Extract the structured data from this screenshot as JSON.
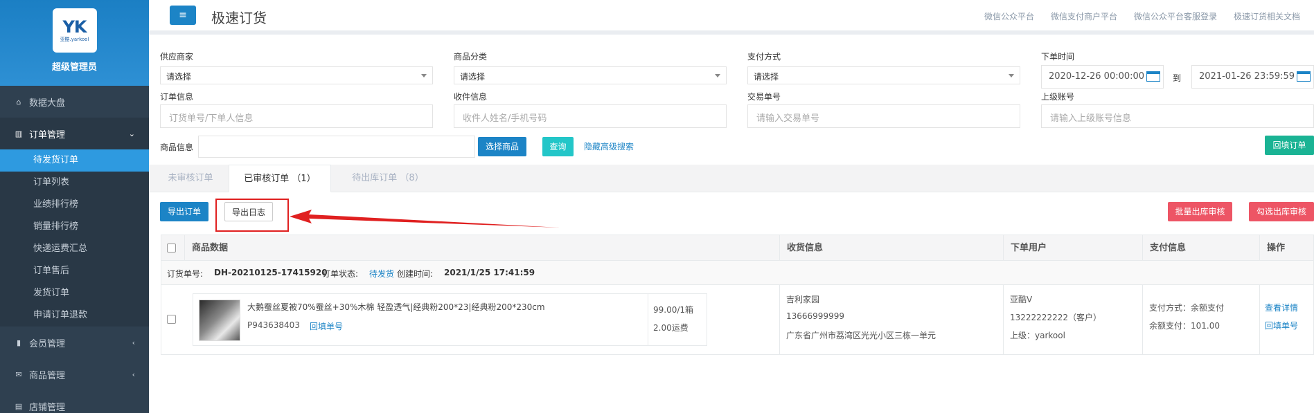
{
  "sidebar": {
    "logo_mark": "YK",
    "logo_text": "亚酷.yarkool",
    "profile_name": "超级管理员",
    "items": [
      {
        "label": "数据大盘",
        "icon": "home-icon"
      },
      {
        "label": "订单管理",
        "icon": "columns-icon",
        "open": true
      },
      {
        "label": "会员管理",
        "icon": "bar-chart-icon"
      },
      {
        "label": "商品管理",
        "icon": "envelope-icon"
      },
      {
        "label": "店铺管理",
        "icon": "store-icon"
      }
    ],
    "sub_items": [
      "待发货订单",
      "订单列表",
      "业绩排行榜",
      "销量排行榜",
      "快递运费汇总",
      "订单售后",
      "发货订单",
      "申请订单退款"
    ]
  },
  "header": {
    "title": "极速订货",
    "links": [
      "微信公众平台",
      "微信支付商户平台",
      "微信公众平台客服登录",
      "极速订货相关文档"
    ]
  },
  "filters": {
    "supplier_label": "供应商家",
    "supplier_value": "请选择",
    "category_label": "商品分类",
    "category_value": "请选择",
    "payment_label": "支付方式",
    "payment_value": "请选择",
    "order_time_label": "下单时间",
    "date_from": "2020-12-26 00:00:00",
    "date_to_label": "到",
    "date_to": "2021-01-26 23:59:59",
    "order_info_label": "订单信息",
    "order_info_placeholder": "订货单号/下单人信息",
    "receiver_label": "收件信息",
    "receiver_placeholder": "收件人姓名/手机号码",
    "trade_label": "交易单号",
    "trade_placeholder": "请输入交易单号",
    "parent_label": "上级账号",
    "parent_placeholder": "请输入上级账号信息",
    "product_label": "商品信息",
    "select_product_btn": "选择商品",
    "query_btn": "查询",
    "hide_advanced_link": "隐藏高级搜索",
    "fill_order_btn": "回填订单"
  },
  "tabs": [
    {
      "label": "未审核订单",
      "active": false
    },
    {
      "label": "已审核订单 （1）",
      "active": true
    },
    {
      "label": "待出库订单 （8）",
      "active": false
    }
  ],
  "actions": {
    "export_orders": "导出订单",
    "export_log": "导出日志",
    "batch_audit": "批量出库审核",
    "selected_audit": "勾选出库审核"
  },
  "table": {
    "headers": [
      "商品数据",
      "收货信息",
      "下单用户",
      "支付信息",
      "操作"
    ],
    "order": {
      "no_label": "订货单号:",
      "no_value": "DH-20210125-17415920",
      "status_label": "订单状态:",
      "status_value": "待发货",
      "created_label": "创建时间:",
      "created_value": "2021/1/25 17:41:59"
    },
    "item": {
      "name": "大鹅蚕丝夏被70%蚕丝+30%木棉 轻盈透气|经典粉200*23|经典粉200*230cm",
      "sku": "P943638403",
      "fill_no_link": "回填单号",
      "price": "99.00/1箱",
      "shipping": "2.00运费"
    },
    "receiver": {
      "name": "吉利家园",
      "phone": "13666999999",
      "address": "广东省广州市荔湾区光光小区三栋一单元"
    },
    "user": {
      "name": "亚酷V",
      "phone": "13222222222（客户）",
      "parent": "上级：yarkool"
    },
    "payment": {
      "method": "支付方式：余额支付",
      "amount": "余额支付：101.00"
    },
    "ops": [
      "查看详情",
      "回填单号"
    ]
  },
  "colors": {
    "sidebar_bg": "#2f4050",
    "primary": "#1c84c6",
    "active_blue": "#2e9ae0",
    "green": "#1ab394",
    "cyan": "#23c6c8",
    "red": "#ed5565",
    "annotation": "#e02020"
  }
}
